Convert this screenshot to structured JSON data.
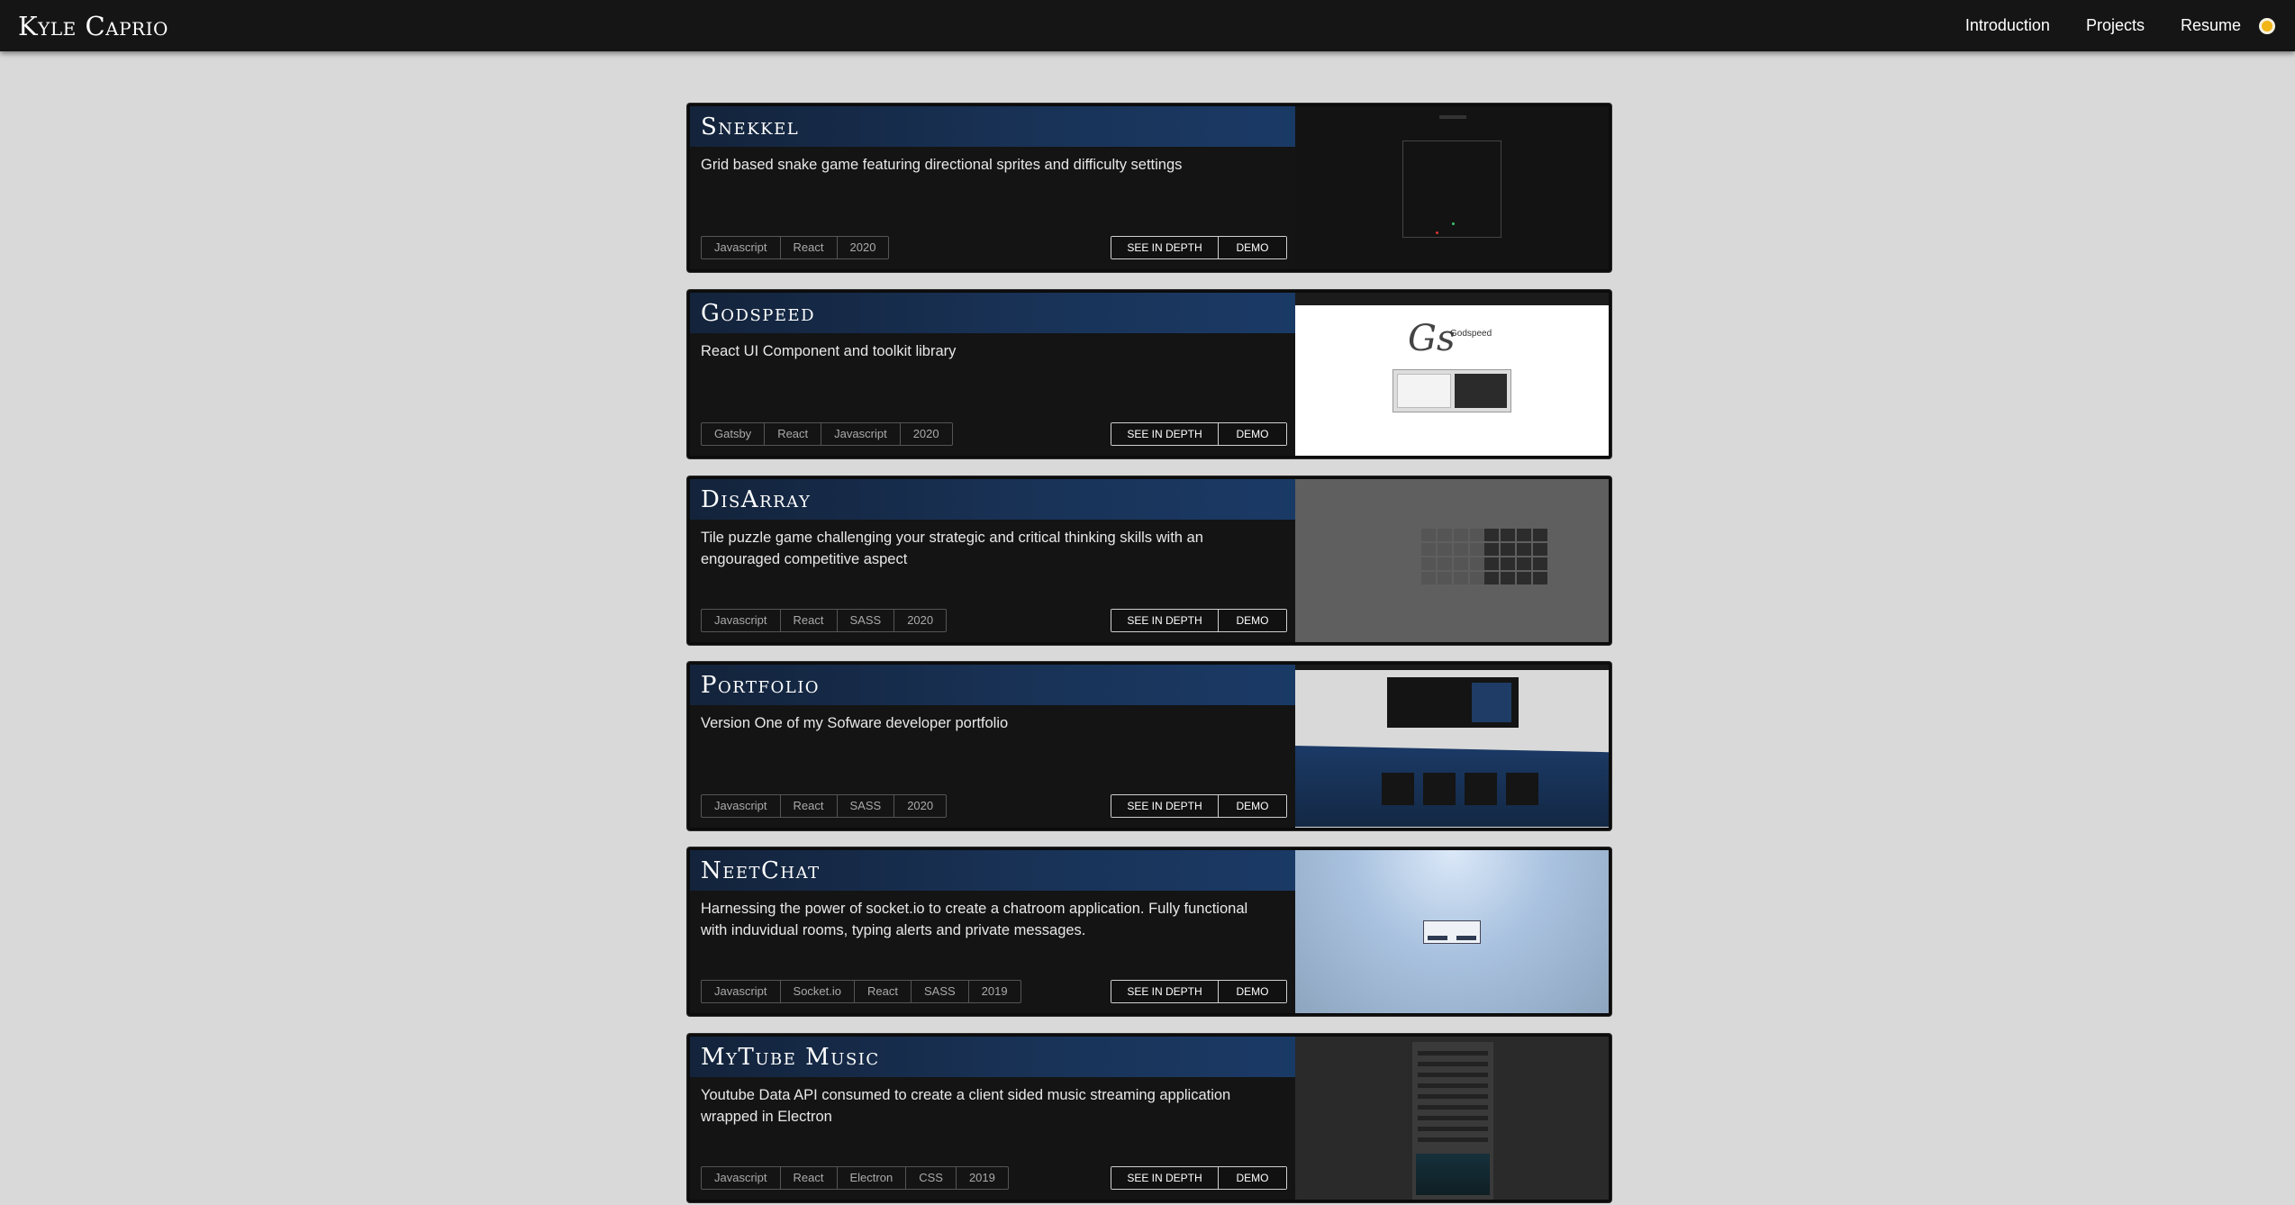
{
  "navbar": {
    "brand": "Kyle Caprio",
    "links": [
      "Introduction",
      "Projects",
      "Resume"
    ],
    "toggle_color": "#f2b516"
  },
  "projects": [
    {
      "title": "Snekkel",
      "description": "Grid based snake game featuring directional sprites and difficulty settings",
      "tags": [
        "Javascript",
        "React",
        "2020"
      ]
    },
    {
      "title": "Godspeed",
      "description": "React UI Component and toolkit library",
      "tags": [
        "Gatsby",
        "React",
        "Javascript",
        "2020"
      ]
    },
    {
      "title": "DisArray",
      "description": "Tile puzzle game challenging your strategic and critical thinking skills with an engouraged competitive aspect",
      "tags": [
        "Javascript",
        "React",
        "SASS",
        "2020"
      ]
    },
    {
      "title": "Portfolio",
      "description": "Version One of my Sofware developer portfolio",
      "tags": [
        "Javascript",
        "React",
        "SASS",
        "2020"
      ]
    },
    {
      "title": "NeetChat",
      "description": "Harnessing the power of socket.io to create a chatroom application. Fully functional with induvidual rooms, typing alerts and private messages.",
      "tags": [
        "Javascript",
        "Socket.io",
        "React",
        "SASS",
        "2019"
      ]
    },
    {
      "title": "MyTube Music",
      "description": "Youtube Data API consumed to create a client sided music streaming application wrapped in Electron",
      "tags": [
        "Javascript",
        "React",
        "Electron",
        "CSS",
        "2019"
      ]
    }
  ],
  "buttons": {
    "depth": "SEE IN DEPTH",
    "demo": "DEMO"
  },
  "thumbnails": {
    "godspeed_name": "Godspeed",
    "godspeed_logo": "Gs"
  },
  "colors": {
    "title_bar": "#193358",
    "card_bg": "#141414",
    "page_bg": "#d9d9d9"
  }
}
